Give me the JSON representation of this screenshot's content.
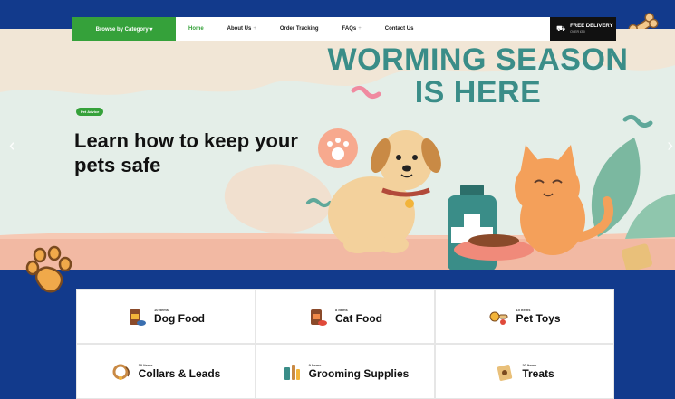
{
  "nav": {
    "browse_label": "Browse by Category ▾",
    "links": [
      {
        "label": "Home",
        "active": true,
        "plus": ""
      },
      {
        "label": "About Us",
        "active": false,
        "plus": "+"
      },
      {
        "label": "Order Tracking",
        "active": false,
        "plus": ""
      },
      {
        "label": "FAQs",
        "active": false,
        "plus": "+"
      },
      {
        "label": "Contact Us",
        "active": false,
        "plus": ""
      }
    ],
    "delivery_title": "FREE DELIVERY",
    "delivery_sub": "OVER £50"
  },
  "hero": {
    "headline_line1": "WORMING SEASON",
    "headline_line2": "IS HERE",
    "pill": "Pet Advice",
    "title": "Learn how to keep your pets safe",
    "prev_arrow": "‹",
    "next_arrow": "›"
  },
  "categories": [
    {
      "count": "10 Items",
      "name": "Dog Food",
      "icon": "dog-food-icon"
    },
    {
      "count": "8 Items",
      "name": "Cat Food",
      "icon": "cat-food-icon"
    },
    {
      "count": "15 Items",
      "name": "Pet Toys",
      "icon": "pet-toys-icon"
    },
    {
      "count": "10 Items",
      "name": "Collars & Leads",
      "icon": "collar-icon"
    },
    {
      "count": "9 Items",
      "name": "Grooming Supplies",
      "icon": "grooming-icon"
    },
    {
      "count": "20 Items",
      "name": "Treats",
      "icon": "treats-icon"
    }
  ],
  "colors": {
    "brand_green": "#35a13a",
    "teal": "#3a8d88",
    "page_bg": "#123a8c"
  }
}
